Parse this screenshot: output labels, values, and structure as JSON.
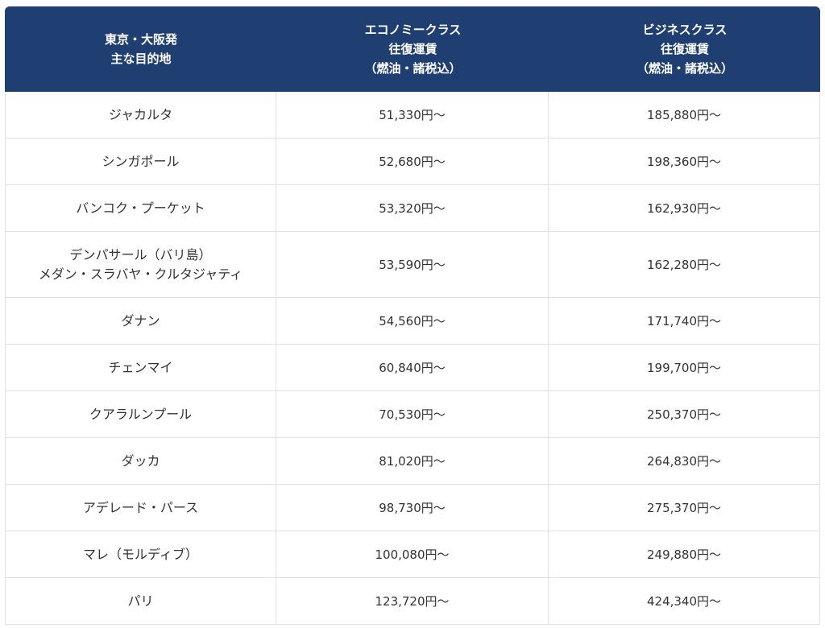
{
  "table": {
    "headers": {
      "destination": [
        "東京・大阪発",
        "主な目的地"
      ],
      "economy": [
        "エコノミークラス",
        "往復運賃",
        "（燃油・諸税込）"
      ],
      "business": [
        "ビジネスクラス",
        "往復運賃",
        "（燃油・諸税込）"
      ]
    },
    "rows": [
      {
        "destination": [
          "ジャカルタ"
        ],
        "economy": "51,330円〜",
        "business": "185,880円〜"
      },
      {
        "destination": [
          "シンガポール"
        ],
        "economy": "52,680円〜",
        "business": "198,360円〜"
      },
      {
        "destination": [
          "バンコク・プーケット"
        ],
        "economy": "53,320円〜",
        "business": "162,930円〜"
      },
      {
        "destination": [
          "デンパサール（バリ島）",
          "メダン・スラバヤ・クルタジャティ"
        ],
        "economy": "53,590円〜",
        "business": "162,280円〜"
      },
      {
        "destination": [
          "ダナン"
        ],
        "economy": "54,560円〜",
        "business": "171,740円〜"
      },
      {
        "destination": [
          "チェンマイ"
        ],
        "economy": "60,840円〜",
        "business": "199,700円〜"
      },
      {
        "destination": [
          "クアラルンプール"
        ],
        "economy": "70,530円〜",
        "business": "250,370円〜"
      },
      {
        "destination": [
          "ダッカ"
        ],
        "economy": "81,020円〜",
        "business": "264,830円〜"
      },
      {
        "destination": [
          "アデレード・パース"
        ],
        "economy": "98,730円〜",
        "business": "275,370円〜"
      },
      {
        "destination": [
          "マレ（モルディブ）"
        ],
        "economy": "100,080円〜",
        "business": "249,880円〜"
      },
      {
        "destination": [
          "パリ"
        ],
        "economy": "123,720円〜",
        "business": "424,340円〜"
      }
    ]
  },
  "colors": {
    "header_bg": "#1f3f72",
    "header_text": "#ffffff",
    "border": "#e2e2e2",
    "body_text": "#333333"
  }
}
